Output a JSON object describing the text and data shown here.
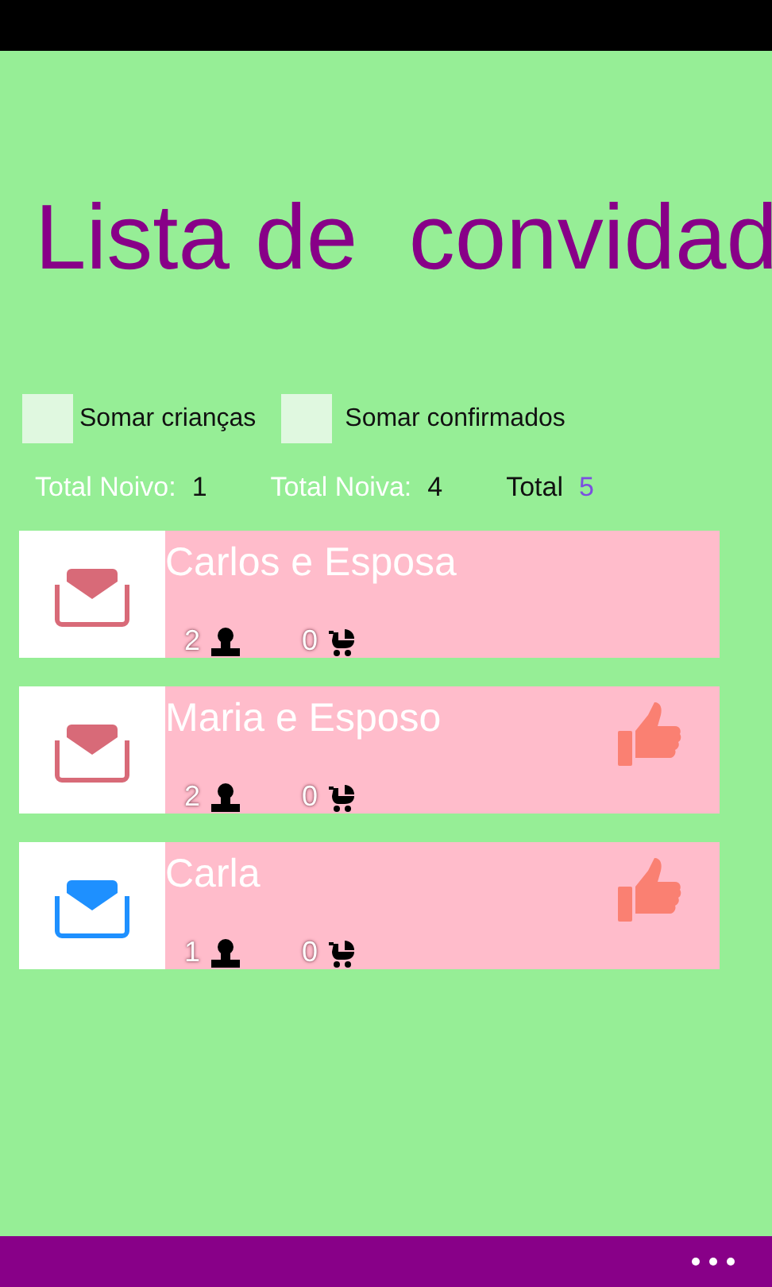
{
  "title": "Lista de  convidad",
  "checkboxes": [
    {
      "label": "Somar crianças",
      "checked": false
    },
    {
      "label": "Somar confirmados",
      "checked": false
    }
  ],
  "totals": [
    {
      "label": "Total Noivo:",
      "value": "1",
      "kind": "side"
    },
    {
      "label": "Total Noiva:",
      "value": "4",
      "kind": "side"
    },
    {
      "label": "Total",
      "value": "5",
      "kind": "grand"
    }
  ],
  "guests": [
    {
      "name": "Carlos e Esposa",
      "adults": "2",
      "children": "0",
      "invite_sent": false,
      "confirmed": false
    },
    {
      "name": "Maria e Esposo",
      "adults": "2",
      "children": "0",
      "invite_sent": false,
      "confirmed": true
    },
    {
      "name": "Carla",
      "adults": "1",
      "children": "0",
      "invite_sent": true,
      "confirmed": true
    }
  ]
}
